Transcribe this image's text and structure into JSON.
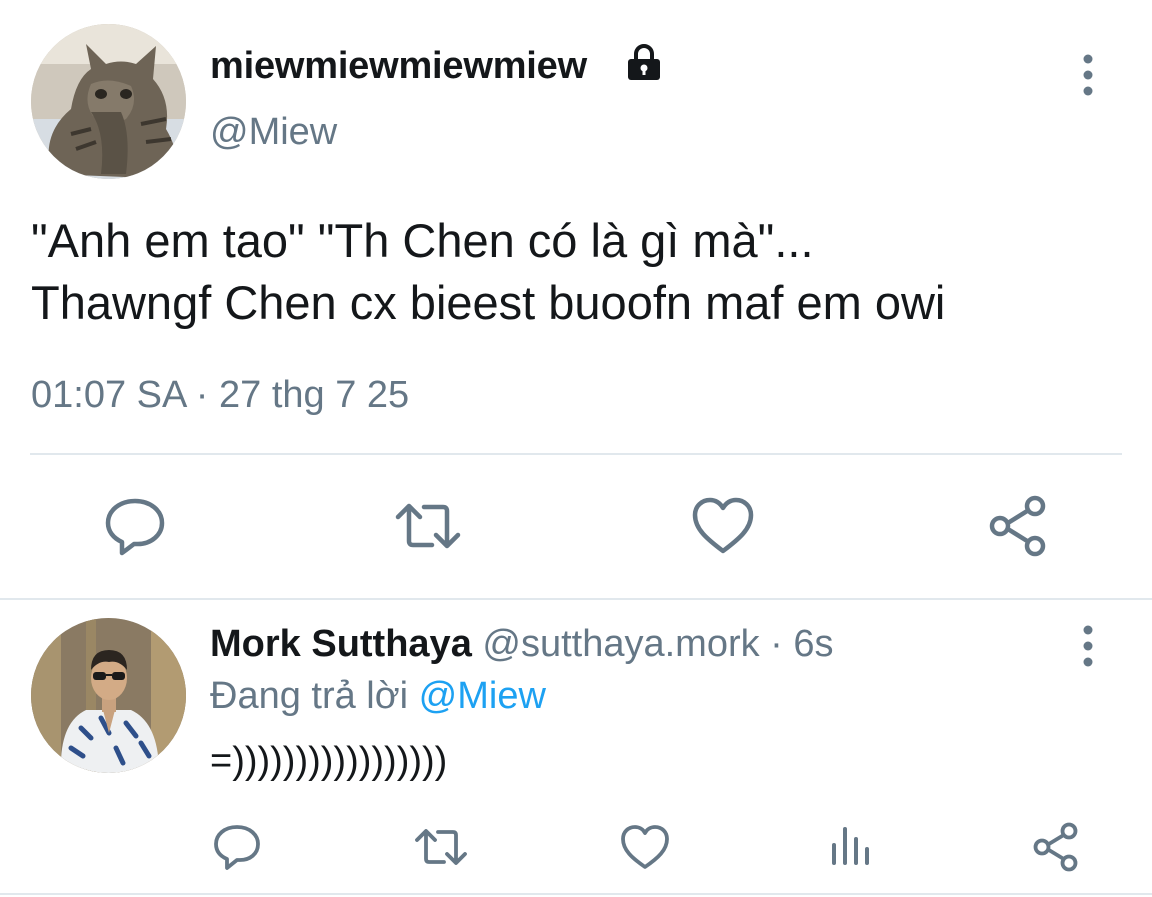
{
  "colors": {
    "text_primary": "#14171a",
    "text_secondary": "#657786",
    "accent": "#1da1f2",
    "divider": "#e1e8ed"
  },
  "main_tweet": {
    "display_name": "miewmiewmiewmiew",
    "protected_icon": "lock-icon",
    "handle": "@Miew",
    "text_lines": [
      "\"Anh em tao\" \"Th Chen có là gì mà\"...",
      "Thawngf Chen cx bieest buoofn maf em owi"
    ],
    "timestamp": "01:07 SA · 27 thg 7 25",
    "actions": [
      "reply-icon",
      "retweet-icon",
      "like-icon",
      "share-icon"
    ]
  },
  "reply_tweet": {
    "display_name": "Mork Sutthaya",
    "handle": "@sutthaya.mork",
    "separator": " · ",
    "time": "6s",
    "replying_prefix": "Đang trả lời ",
    "replying_mention": "@Miew",
    "text": "=)))))))))))))))))",
    "actions": [
      "reply-icon",
      "retweet-icon",
      "like-icon",
      "stats-icon",
      "share-icon"
    ]
  }
}
